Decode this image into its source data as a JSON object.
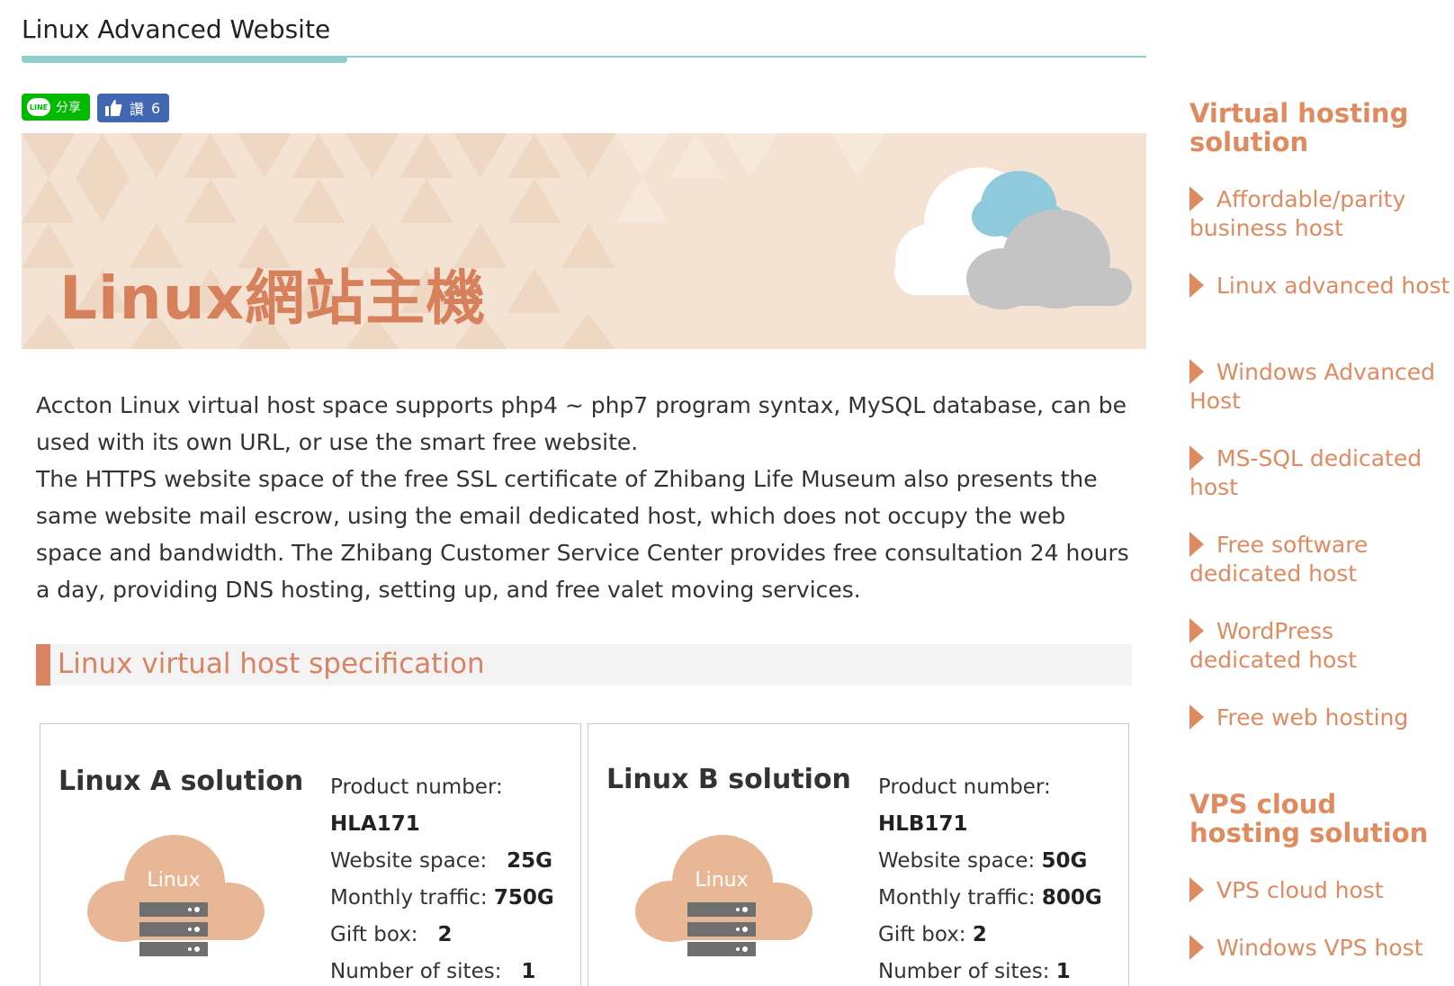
{
  "page": {
    "title": "Linux Advanced Website"
  },
  "social": {
    "line_label": "分享",
    "line_logo": "LINE",
    "like_label": "讚",
    "like_count": "6"
  },
  "banner": {
    "text": "Linux網站主機",
    "colors": {
      "bg": "#f4e3d2",
      "text": "#d7805c",
      "cloud_blue": "#8ec9dc",
      "cloud_grey": "#c4c4c4"
    }
  },
  "intro": {
    "paragraph1": "Accton Linux virtual host space supports php4 ~ php7 program syntax, MySQL database, can be used with its own URL, or use the smart free website.",
    "paragraph2": "The HTTPS website space of the free SSL certificate of Zhibang Life Museum also presents the same website mail escrow, using the email dedicated host, which does not occupy the web space and bandwidth. The Zhibang Customer Service Center provides free consultation 24 hours a day, providing DNS hosting, setting up, and free valet moving services."
  },
  "section": {
    "title": "Linux virtual host specification"
  },
  "plans": [
    {
      "name": "Linux A solution",
      "cloud_label": "Linux",
      "product_number_label": "Product number:",
      "product_number": "HLA171",
      "space_label": "Website space:",
      "space": "25G",
      "traffic_label": "Monthly traffic:",
      "traffic": "750G",
      "gift_label": "Gift box:",
      "gift": "2",
      "sites_label": "Number of sites:",
      "sites": "1"
    },
    {
      "name": "Linux B solution",
      "cloud_label": "Linux",
      "product_number_label": "Product number:",
      "product_number": "HLB171",
      "space_label": "Website space:",
      "space": "50G",
      "traffic_label": "Monthly traffic:",
      "traffic": "800G",
      "gift_label": "Gift box:",
      "gift": "2",
      "sites_label": "Number of sites:",
      "sites": "1"
    }
  ],
  "sidebar": {
    "virtual_heading": "Virtual hosting solution",
    "virtual_links": [
      "Affordable/parity business host",
      "Linux advanced host",
      "Windows Advanced Host",
      "MS-SQL dedicated host",
      "Free software dedicated host",
      "WordPress dedicated host",
      "Free web hosting"
    ],
    "vps_heading": "VPS cloud hosting solution",
    "vps_links": [
      "VPS cloud host",
      "Windows VPS host"
    ],
    "accent": "#e08a60"
  }
}
